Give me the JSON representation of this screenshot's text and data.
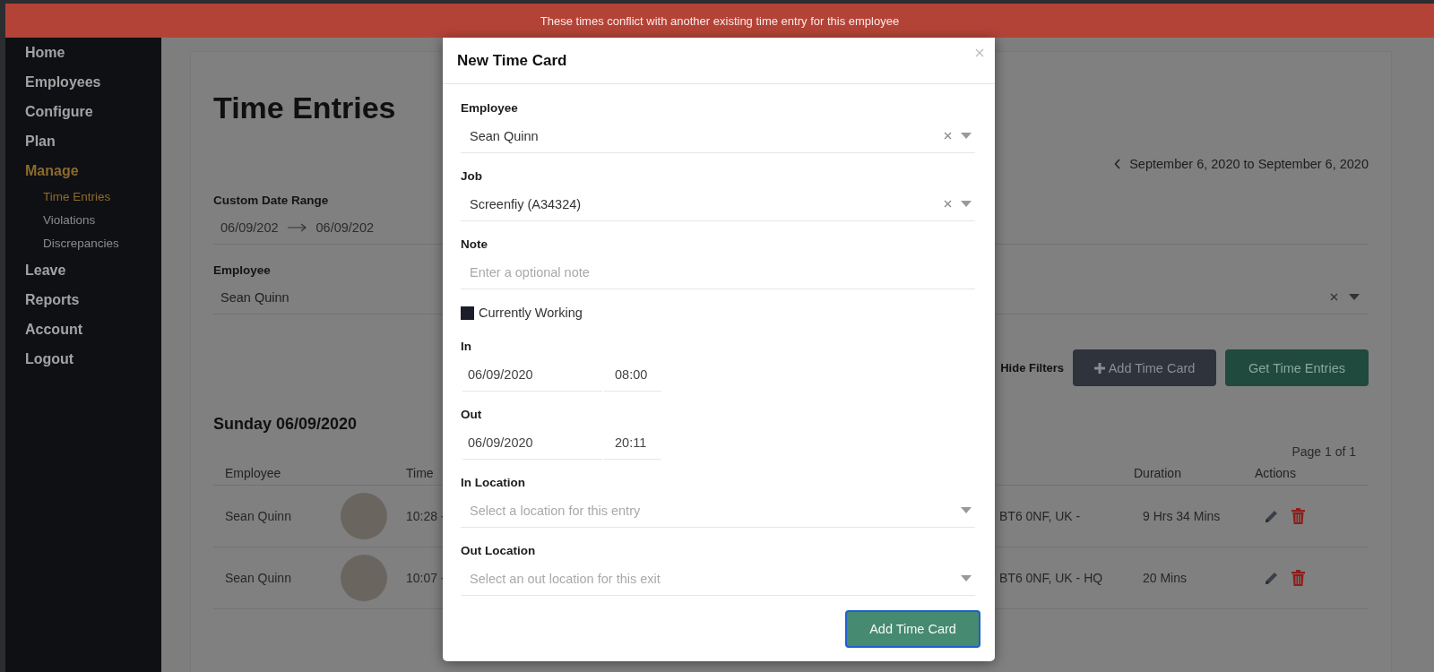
{
  "banner": {
    "message": "These times conflict with another existing time entry for this employee"
  },
  "sidebar": {
    "items": [
      {
        "label": "Home",
        "selected": false
      },
      {
        "label": "Employees",
        "selected": false
      },
      {
        "label": "Configure",
        "selected": false
      },
      {
        "label": "Plan",
        "selected": false
      },
      {
        "label": "Manage",
        "selected": true,
        "children": [
          {
            "label": "Time Entries",
            "selected": true
          },
          {
            "label": "Violations",
            "selected": false
          },
          {
            "label": "Discrepancies",
            "selected": false
          }
        ]
      },
      {
        "label": "Leave",
        "selected": false
      },
      {
        "label": "Reports",
        "selected": false
      },
      {
        "label": "Account",
        "selected": false
      },
      {
        "label": "Logout",
        "selected": false
      }
    ]
  },
  "page": {
    "title": "Time Entries",
    "date_range": "September 6, 2020 to September 6, 2020",
    "filters": {
      "date_range": {
        "label": "Custom Date Range",
        "start": "06/09/202",
        "end": "06/09/202"
      },
      "employee": {
        "label": "Employee",
        "value": "Sean Quinn",
        "clearable": true
      }
    },
    "hide_filters": "Hide Filters",
    "add_button": "Add Time Card",
    "get_button": "Get Time Entries"
  },
  "day": {
    "heading": "Sunday 06/09/2020",
    "pagination": "Page 1 of 1",
    "columns": {
      "employee": "Employee",
      "time": "Time",
      "duration": "Duration",
      "actions": "Actions"
    },
    "rows": [
      {
        "employee": "Sean Quinn",
        "time": "10:28 -",
        "location": "BT6 0NF, UK -",
        "duration": "9 Hrs 34 Mins"
      },
      {
        "employee": "Sean Quinn",
        "time": "10:07 -",
        "location": "BT6 0NF, UK - HQ",
        "duration": "20 Mins"
      }
    ]
  },
  "modal": {
    "title": "New Time Card",
    "fields": [
      {
        "kind": "select",
        "label": "Employee",
        "value": "Sean Quinn",
        "clearable": true
      },
      {
        "kind": "select",
        "label": "Job",
        "value": "Screenfiy (A34324)",
        "clearable": true
      },
      {
        "kind": "text",
        "label": "Note",
        "placeholder": "Enter a optional note"
      },
      {
        "kind": "checkbox",
        "label": "Currently Working",
        "checked": false
      },
      {
        "kind": "datetime",
        "label": "In",
        "date": "06/09/2020",
        "time": "08:00"
      },
      {
        "kind": "datetime",
        "label": "Out",
        "date": "06/09/2020",
        "time": "20:11"
      },
      {
        "kind": "select",
        "label": "In Location",
        "placeholder": "Select a location for this entry",
        "clearable": false
      },
      {
        "kind": "select",
        "label": "Out Location",
        "placeholder": "Select an out location for this exit",
        "clearable": false
      }
    ],
    "submit": "Add Time Card"
  }
}
